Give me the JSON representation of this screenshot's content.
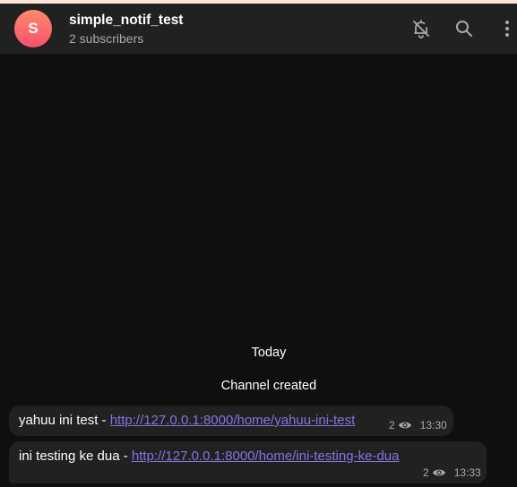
{
  "header": {
    "avatar_initial": "S",
    "title": "simple_notif_test",
    "subtitle": "2 subscribers",
    "icons": [
      "bell-off-icon",
      "search-icon",
      "more-vertical-icon"
    ]
  },
  "chat": {
    "date_label": "Today",
    "service_message": "Channel created",
    "messages": [
      {
        "text": "yahuu ini test - ",
        "link": "http://127.0.0.1:8000/home/yahuu-ini-test",
        "views": "2",
        "time": "13:30"
      },
      {
        "text": "ini testing ke dua - ",
        "link": "http://127.0.0.1:8000/home/ini-testing-ke-dua",
        "views": "2",
        "time": "13:33"
      }
    ]
  },
  "colors": {
    "background": "#0f0f0f",
    "header": "#212121",
    "bubble": "#212121",
    "link": "#8774e1",
    "muted": "#aaaaaa",
    "avatar_gradient": [
      "#ff8a6b",
      "#f6516e"
    ]
  }
}
